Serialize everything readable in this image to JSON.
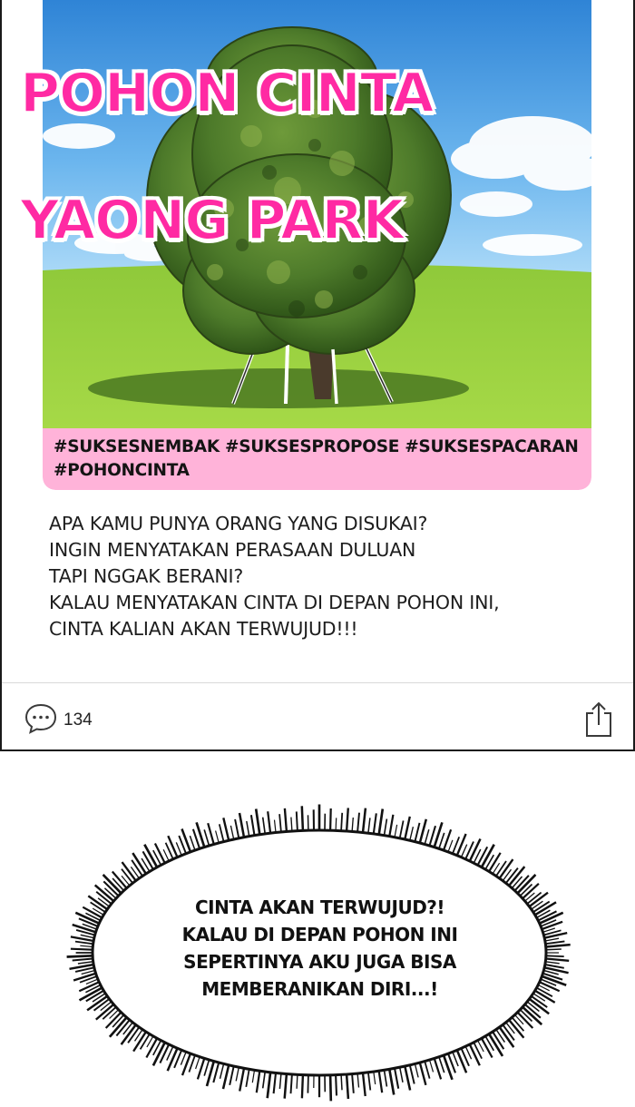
{
  "post": {
    "title_line1": "POHON CINTA",
    "title_line2": "YAONG PARK",
    "hashtags": [
      "#SUKSESNEMBAK",
      "#SUKSESPROPOSE",
      "#SUKSESPACARAN",
      "#POHONCINTA"
    ],
    "body_lines": [
      "APA KAMU PUNYA ORANG YANG DISUKAI?",
      "INGIN MENYATAKAN PERASAAN DULUAN",
      "TAPI NGGAK BERANI?",
      "KALAU MENYATAKAN CINTA DI DEPAN POHON INI,",
      "CINTA KALIAN AKAN TERWUJUD!!!"
    ],
    "comment_count": "134",
    "title_color": "#ff2aa3",
    "hashtag_bg": "#ffb3d9"
  },
  "icons": {
    "comment": "comment-bubble-icon",
    "share": "share-icon"
  },
  "speech_bubble": {
    "lines": [
      "CINTA AKAN TERWUJUD?!",
      "KALAU DI DEPAN POHON INI",
      "SEPERTINYA AKU JUGA BISA",
      "MEMBERANIKAN DIRI...!"
    ]
  }
}
